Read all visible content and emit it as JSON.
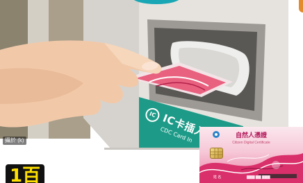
{
  "photo": {
    "credit_text": "攝於 (k)",
    "slot_label_main": "IC卡插入",
    "slot_label_sub": "CDC Card In",
    "slot_icon_text": "IC"
  },
  "inset_card": {
    "title": "自然人憑證",
    "subtitle": "Citizen Digital Certificate",
    "field_label": "姓 名",
    "field_value": "▇▇▇ ▇▇ ▇▇▇"
  },
  "headline": {
    "text": "1百"
  },
  "colors": {
    "kiosk_body": "#e7e4df",
    "slot_panel": "#1c9b87",
    "card_pink": "#e64f80",
    "headline_yellow": "#ffe000"
  }
}
